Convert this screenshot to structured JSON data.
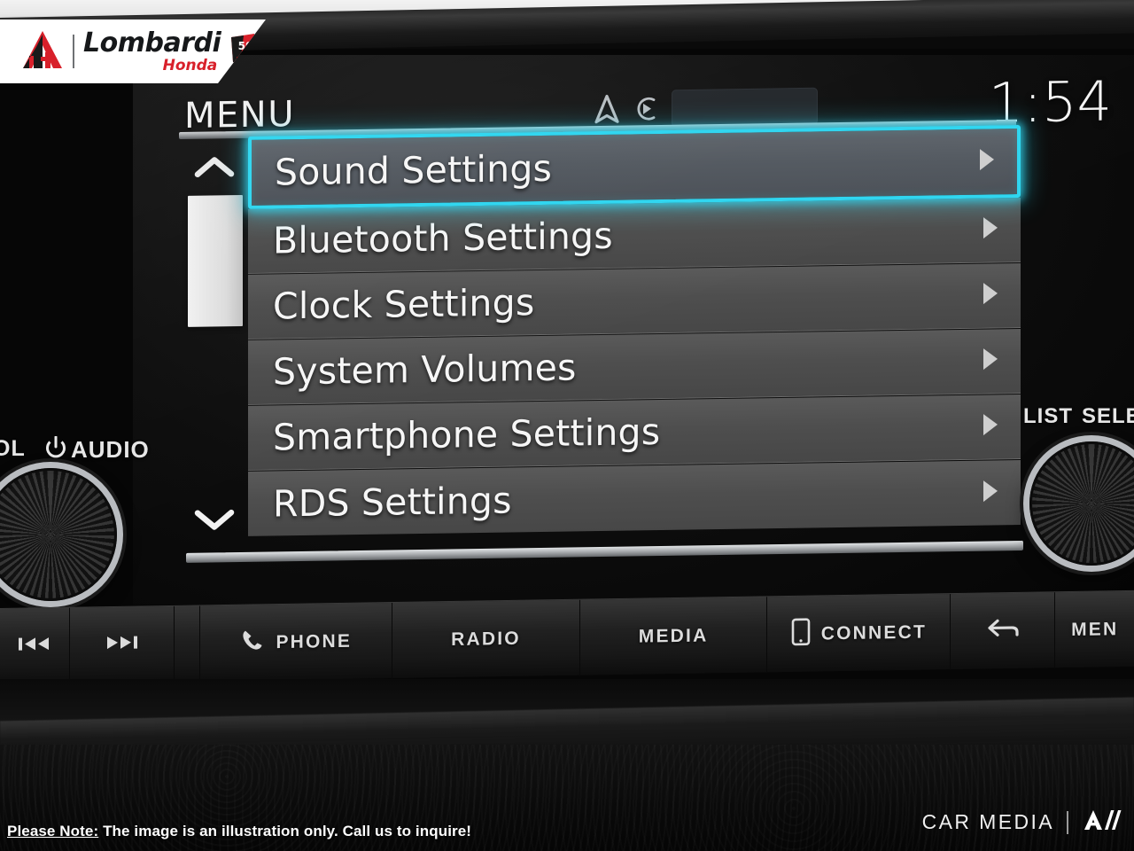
{
  "dealer": {
    "name": "Lombardi",
    "sub": "Honda",
    "logo_icon": "lombardi-a-h-monogram",
    "badge_icon": "honda-50th-anniversary-badge"
  },
  "head_unit": {
    "screen_title": "MENU",
    "clock": "1:54",
    "status_icons": [
      {
        "name": "navigation-arrow-icon"
      },
      {
        "name": "media-play-circle-icon"
      }
    ],
    "status_slot_placeholder": ""
  },
  "menu": {
    "scroll_up_icon": "chevron-up-icon",
    "scroll_down_icon": "chevron-down-icon",
    "row_chevron_icon": "chevron-right-icon",
    "selected_index": 0,
    "accent_color": "#2fd6f0",
    "row_bg_color": "#4e4e4e",
    "row_selected_bg_color": "#545a61",
    "items": [
      {
        "label": "Sound Settings",
        "selected": true
      },
      {
        "label": "Bluetooth Settings",
        "selected": false
      },
      {
        "label": "Clock Settings",
        "selected": false
      },
      {
        "label": "System Volumes",
        "selected": false
      },
      {
        "label": "Smartphone Settings",
        "selected": false
      },
      {
        "label": "RDS Settings",
        "selected": false
      }
    ]
  },
  "hardware": {
    "left_knob": {
      "power_icon": "power-icon",
      "label": "AUDIO",
      "secondary_label": "OL"
    },
    "right_knob": {
      "label_left": "LIST",
      "label_right": "SELEC"
    },
    "buttons": [
      {
        "label": "",
        "icon": "skip-previous-icon"
      },
      {
        "label": "",
        "icon": "skip-next-icon"
      },
      {
        "label": "PHONE",
        "icon": "phone-handset-icon"
      },
      {
        "label": "RADIO",
        "icon": ""
      },
      {
        "label": "MEDIA",
        "icon": ""
      },
      {
        "label": "CONNECT",
        "icon": "smartphone-icon"
      },
      {
        "label": "",
        "icon": "back-arrow-icon"
      },
      {
        "label": "MEN",
        "icon": ""
      }
    ]
  },
  "footer": {
    "note_bold": "Please Note:",
    "note_rest": " The image is an illustration only. Call us to inquire!",
    "brand": "CAR MEDIA",
    "brand_logo_icon": "av-slash-logo"
  }
}
